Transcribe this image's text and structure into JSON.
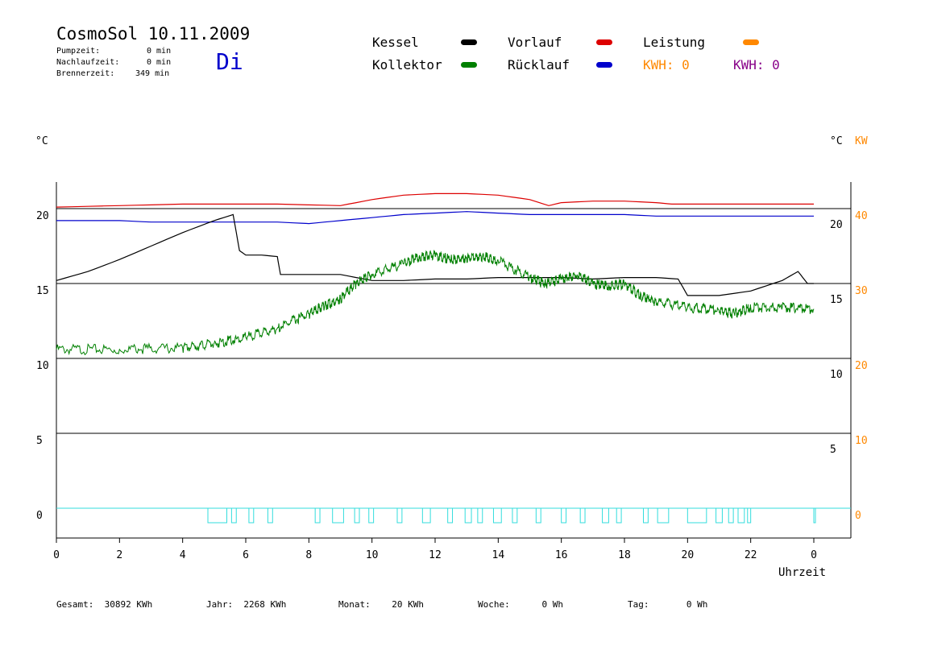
{
  "header": {
    "title": "CosmoSol 10.11.2009",
    "weekday": "Di",
    "stats": [
      {
        "label": "Pumpzeit:",
        "value": "0 min"
      },
      {
        "label": "Nachlaufzeit:",
        "value": "0 min"
      },
      {
        "label": "Brennerzeit:",
        "value": "349 min"
      }
    ]
  },
  "legend": {
    "items": [
      {
        "label": "Kessel",
        "color": "#000000"
      },
      {
        "label": "Vorlauf",
        "color": "#dd0000"
      },
      {
        "label": "Leistung",
        "color": "#ff8800"
      },
      {
        "label": "Kollektor",
        "color": "#008000"
      },
      {
        "label": "Rücklauf",
        "color": "#0000cc"
      }
    ],
    "kwh_orange": "KWH: 0",
    "kwh_orange_color": "#ff8800",
    "kwh_purple": "KWH: 0",
    "kwh_purple_color": "#880088"
  },
  "footer": [
    {
      "label": "Gesamt:",
      "value": "30892 KWh"
    },
    {
      "label": "Jahr:",
      "value": "2268 KWh"
    },
    {
      "label": "Monat:",
      "value": "20 KWh"
    },
    {
      "label": "Woche:",
      "value": "0 Wh"
    },
    {
      "label": "Tag:",
      "value": "0 Wh"
    }
  ],
  "chart_data": {
    "type": "line",
    "xlabel": "Uhrzeit",
    "ylabel_left": "°C",
    "ylabel_right": "°C",
    "ylabel_right2": "KW",
    "xlim": [
      0,
      25
    ],
    "ylim": [
      -1.5,
      22
    ],
    "x_ticks": [
      0,
      2,
      4,
      6,
      8,
      10,
      12,
      14,
      16,
      18,
      20,
      22,
      24
    ],
    "x_tick_labels": [
      "0",
      "2",
      "4",
      "6",
      "8",
      "10",
      "12",
      "14",
      "16",
      "18",
      "20",
      "22",
      "0"
    ],
    "y_ticks_left": [
      0,
      5,
      10,
      15,
      20
    ],
    "y_ticks_right_celsius": [
      5,
      10,
      15,
      20
    ],
    "y_ticks_right_kw": [
      0,
      10,
      20,
      30,
      40
    ],
    "grid_y": [
      0,
      5,
      10,
      15,
      20
    ],
    "series": [
      {
        "name": "Vorlauf",
        "color": "#dd0000",
        "x": [
          0,
          2,
          4,
          6,
          7,
          9,
          10,
          11,
          12,
          13,
          14,
          15,
          15.6,
          16,
          17,
          18,
          19,
          19.5,
          20,
          22,
          24
        ],
        "y": [
          20.1,
          20.2,
          20.3,
          20.3,
          20.3,
          20.2,
          20.6,
          20.9,
          21.0,
          21.0,
          20.9,
          20.6,
          20.2,
          20.4,
          20.5,
          20.5,
          20.4,
          20.3,
          20.3,
          20.3,
          20.3
        ]
      },
      {
        "name": "Rücklauf",
        "color": "#0000cc",
        "x": [
          0,
          2,
          3,
          4,
          5,
          6,
          7,
          8,
          9,
          10,
          11,
          12,
          13,
          14,
          15,
          16,
          17,
          18,
          19,
          20,
          22,
          24
        ],
        "y": [
          19.2,
          19.2,
          19.1,
          19.1,
          19.1,
          19.1,
          19.1,
          19.0,
          19.2,
          19.4,
          19.6,
          19.7,
          19.8,
          19.7,
          19.6,
          19.6,
          19.6,
          19.6,
          19.5,
          19.5,
          19.5,
          19.5
        ]
      },
      {
        "name": "Kessel",
        "color": "#000000",
        "x": [
          0,
          1,
          2,
          3,
          4,
          5,
          5.6,
          5.8,
          6.0,
          6.5,
          7.0,
          7.1,
          8.0,
          9.0,
          10.0,
          11.0,
          12.0,
          13.0,
          14.0,
          15.0,
          16.0,
          17.0,
          18.0,
          19.0,
          19.7,
          20.0,
          21.0,
          22.0,
          23.0,
          23.5,
          23.8,
          24.0
        ],
        "y": [
          15.2,
          15.8,
          16.6,
          17.5,
          18.4,
          19.2,
          19.6,
          17.2,
          16.9,
          16.9,
          16.8,
          15.6,
          15.6,
          15.6,
          15.2,
          15.2,
          15.3,
          15.3,
          15.4,
          15.4,
          15.4,
          15.3,
          15.4,
          15.4,
          15.3,
          14.2,
          14.2,
          14.5,
          15.2,
          15.8,
          15.0,
          15.0
        ]
      },
      {
        "name": "Kollektor",
        "color": "#008000",
        "x": [
          0,
          2,
          4,
          5,
          6,
          7,
          8,
          8.5,
          9,
          9.5,
          10,
          11,
          11.5,
          12,
          12.5,
          13,
          13.5,
          14,
          15,
          15.5,
          16,
          16.5,
          17,
          17.5,
          18,
          18.5,
          19,
          20,
          21,
          21.5,
          22,
          23,
          24
        ],
        "y": [
          10.6,
          10.6,
          10.7,
          11.0,
          11.4,
          12.0,
          13.0,
          13.5,
          14.0,
          15.0,
          15.6,
          16.3,
          16.8,
          16.9,
          16.6,
          16.7,
          16.8,
          16.5,
          15.4,
          15.0,
          15.3,
          15.6,
          15.0,
          14.8,
          15.0,
          14.2,
          13.8,
          13.4,
          13.2,
          13.0,
          13.4,
          13.4,
          13.3
        ]
      },
      {
        "name": "Brenner",
        "color": "#33dddd",
        "x": [
          0,
          24
        ],
        "y": [
          0,
          0
        ]
      }
    ],
    "brenner_pulses": [
      [
        4.8,
        5.4
      ],
      [
        5.55,
        5.7
      ],
      [
        6.1,
        6.25
      ],
      [
        6.7,
        6.85
      ],
      [
        8.2,
        8.35
      ],
      [
        8.75,
        9.1
      ],
      [
        9.45,
        9.6
      ],
      [
        9.9,
        10.05
      ],
      [
        10.8,
        10.95
      ],
      [
        11.6,
        11.85
      ],
      [
        12.4,
        12.55
      ],
      [
        12.95,
        13.15
      ],
      [
        13.35,
        13.5
      ],
      [
        13.85,
        14.1
      ],
      [
        14.45,
        14.6
      ],
      [
        15.2,
        15.35
      ],
      [
        16.0,
        16.15
      ],
      [
        16.6,
        16.75
      ],
      [
        17.3,
        17.5
      ],
      [
        17.75,
        17.9
      ],
      [
        18.6,
        18.75
      ],
      [
        19.05,
        19.4
      ],
      [
        20.0,
        20.6
      ],
      [
        20.9,
        21.1
      ],
      [
        21.3,
        21.45
      ],
      [
        21.6,
        21.8
      ],
      [
        21.9,
        22.0
      ],
      [
        24.0,
        24.05
      ]
    ]
  }
}
